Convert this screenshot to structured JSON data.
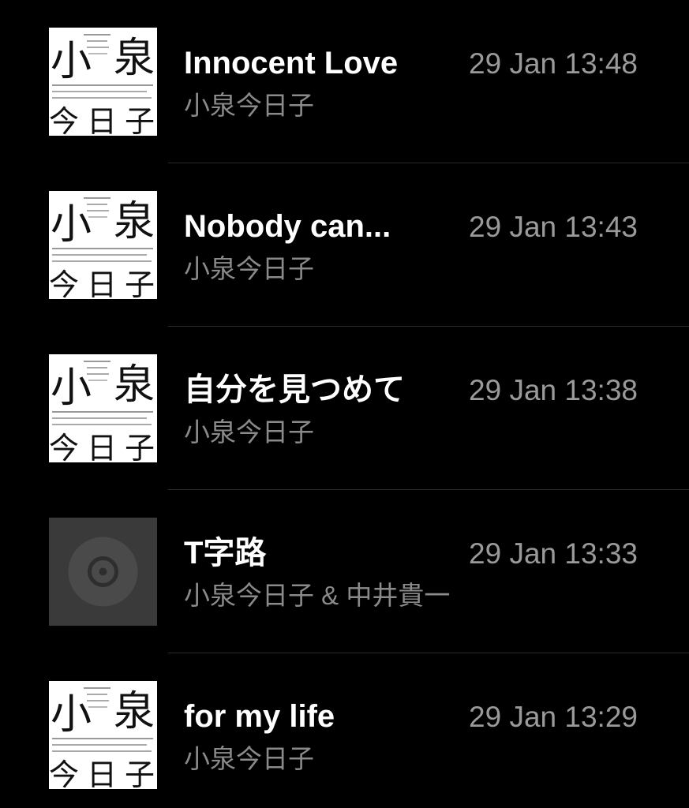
{
  "tracks": [
    {
      "title": "Innocent Love",
      "artist": "小泉今日子",
      "time": "29 Jan 13:48",
      "artwork": "album-cover"
    },
    {
      "title": "Nobody can...",
      "artist": "小泉今日子",
      "time": "29 Jan 13:43",
      "artwork": "album-cover"
    },
    {
      "title": "自分を見つめて",
      "artist": "小泉今日子",
      "time": "29 Jan 13:38",
      "artwork": "album-cover"
    },
    {
      "title": "T字路",
      "artist": "小泉今日子 & 中井貴一",
      "time": "29 Jan 13:33",
      "artwork": "placeholder-disc-icon"
    },
    {
      "title": "for my life",
      "artist": "小泉今日子",
      "time": "29 Jan 13:29",
      "artwork": "album-cover"
    }
  ],
  "cover": {
    "big_chars": [
      "小",
      "泉",
      "今",
      "日",
      "子"
    ]
  },
  "colors": {
    "background": "#000000",
    "title": "#ffffff",
    "artist": "#8a8a8a",
    "time": "#9a9a9a",
    "divider": "#2b2b2b",
    "placeholder": "#3a3a3a"
  }
}
